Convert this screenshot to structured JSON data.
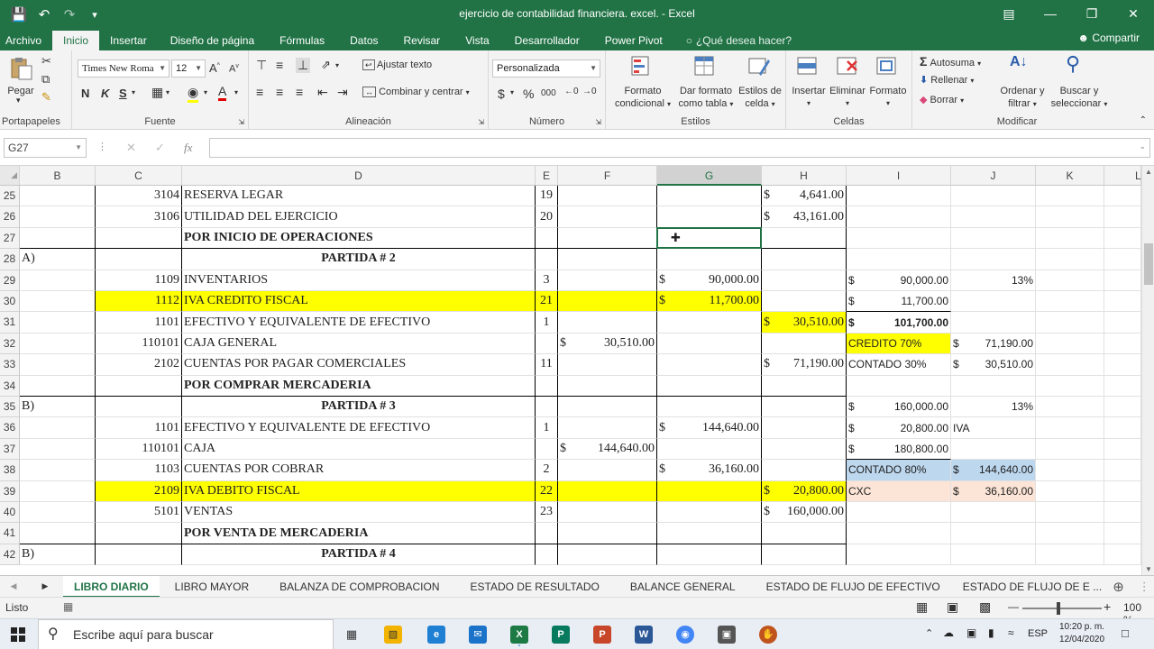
{
  "window": {
    "title": "ejercicio de contabilidad financiera. excel. - Excel",
    "qat": {
      "save": "save-icon",
      "undo": "undo-icon",
      "redo": "redo-icon",
      "customize": "customize-icon"
    }
  },
  "ribbon_tabs": [
    "Archivo",
    "Inicio",
    "Insertar",
    "Diseño de página",
    "Fórmulas",
    "Datos",
    "Revisar",
    "Vista",
    "Desarrollador",
    "Power Pivot"
  ],
  "tell_me": "¿Qué desea hacer?",
  "share": "Compartir",
  "ribbon": {
    "clipboard": {
      "paste": "Pegar",
      "label": "Portapapeles"
    },
    "font": {
      "name": "Times New Roma",
      "size": "12",
      "bold": "N",
      "italic": "K",
      "underline": "S",
      "label": "Fuente"
    },
    "alignment": {
      "wrap": "Ajustar texto",
      "merge": "Combinar y centrar",
      "label": "Alineación"
    },
    "number": {
      "format": "Personalizada",
      "currency": "$",
      "percent": "%",
      "thousands": "000",
      "label": "Número"
    },
    "styles": {
      "conditional": [
        "Formato",
        "condicional"
      ],
      "table": [
        "Dar formato",
        "como tabla"
      ],
      "cell_styles": [
        "Estilos de",
        "celda"
      ],
      "label": "Estilos"
    },
    "cells": {
      "insert": "Insertar",
      "delete": "Eliminar",
      "format": "Formato",
      "label": "Celdas"
    },
    "editing": {
      "autosum": "Autosuma",
      "fill": "Rellenar",
      "clear": "Borrar",
      "sort": [
        "Ordenar y",
        "filtrar"
      ],
      "find": [
        "Buscar y",
        "seleccionar"
      ],
      "label": "Modificar"
    }
  },
  "namebox": "G27",
  "columns": [
    "B",
    "C",
    "D",
    "E",
    "F",
    "G",
    "H",
    "I",
    "J",
    "K",
    "L"
  ],
  "rows": [
    {
      "n": "25",
      "B": "",
      "C": "3104",
      "D": "RESERVA LEGAR",
      "E": "19",
      "F": "",
      "G": "",
      "Hs": "$",
      "Hv": "4,641.00",
      "Is": "",
      "Iv": "",
      "J": "",
      "Js": ""
    },
    {
      "n": "26",
      "B": "",
      "C": "3106",
      "D": "UTILIDAD DEL EJERCICIO",
      "E": "20",
      "F": "",
      "G": "",
      "Hs": "$",
      "Hv": "43,161.00",
      "Is": "",
      "Iv": "",
      "J": "",
      "Js": ""
    },
    {
      "n": "27",
      "B": "",
      "C": "",
      "D": "POR INICIO DE OPERACIONES",
      "E": "",
      "F": "",
      "G": "",
      "Hs": "",
      "Hv": "",
      "Is": "",
      "Iv": "",
      "J": "",
      "Js": ""
    },
    {
      "n": "28",
      "B": "A)",
      "C": "",
      "D": "PARTIDA # 2",
      "E": "",
      "F": "",
      "G": "",
      "Hs": "",
      "Hv": "",
      "Is": "",
      "Iv": "",
      "J": "",
      "Js": ""
    },
    {
      "n": "29",
      "B": "",
      "C": "1109",
      "D": "INVENTARIOS",
      "E": "3",
      "F": "",
      "Gs": "$",
      "Gv": "90,000.00",
      "Hs": "",
      "Hv": "",
      "Is": "$",
      "Iv": "90,000.00",
      "J": "13%",
      "Js": ""
    },
    {
      "n": "30",
      "B": "",
      "C": "1112",
      "D": "IVA CREDITO FISCAL",
      "E": "21",
      "F": "",
      "Gs": "$",
      "Gv": "11,700.00",
      "Hs": "",
      "Hv": "",
      "Is": "$",
      "Iv": "11,700.00",
      "J": "",
      "Js": ""
    },
    {
      "n": "31",
      "B": "",
      "C": "1101",
      "D": "EFECTIVO Y EQUIVALENTE DE EFECTIVO",
      "E": "1",
      "F": "",
      "G": "",
      "Hs": "$",
      "Hv": "30,510.00",
      "Is": "$",
      "Iv": "101,700.00",
      "J": "",
      "Js": ""
    },
    {
      "n": "32",
      "B": "",
      "C": "110101",
      "D": "CAJA GENERAL",
      "E": "",
      "Fs": "$",
      "Fv": "30,510.00",
      "G": "",
      "Hs": "",
      "Hv": "",
      "Itext": "CREDITO   70%",
      "Js": "$",
      "Jv": "71,190.00"
    },
    {
      "n": "33",
      "B": "",
      "C": "2102",
      "D": "CUENTAS POR PAGAR COMERCIALES",
      "E": "11",
      "F": "",
      "G": "",
      "Hs": "$",
      "Hv": "71,190.00",
      "Itext": "CONTADO 30%",
      "Js": "$",
      "Jv": "30,510.00"
    },
    {
      "n": "34",
      "B": "",
      "C": "",
      "D": "POR COMPRAR MERCADERIA",
      "E": "",
      "F": "",
      "G": "",
      "Hs": "",
      "Hv": "",
      "Is": "",
      "Iv": "",
      "J": "",
      "Js": ""
    },
    {
      "n": "35",
      "B": "B)",
      "C": "",
      "D": "PARTIDA # 3",
      "E": "",
      "F": "",
      "G": "",
      "Hs": "",
      "Hv": "",
      "Is": "$",
      "Iv": "160,000.00",
      "J": "13%",
      "Js": ""
    },
    {
      "n": "36",
      "B": "",
      "C": "1101",
      "D": "EFECTIVO Y EQUIVALENTE DE EFECTIVO",
      "E": "1",
      "F": "",
      "Gs": "$",
      "Gv": "144,640.00",
      "Hs": "",
      "Hv": "",
      "Is": "$",
      "Iv": "20,800.00",
      "Jtext": "IVA"
    },
    {
      "n": "37",
      "B": "",
      "C": "110101",
      "D": "CAJA",
      "E": "",
      "Fs": "$",
      "Fv": "144,640.00",
      "G": "",
      "Hs": "",
      "Hv": "",
      "Is": "$",
      "Iv": "180,800.00",
      "J": "",
      "Js": ""
    },
    {
      "n": "38",
      "B": "",
      "C": "1103",
      "D": "CUENTAS POR COBRAR",
      "E": "2",
      "F": "",
      "Gs": "$",
      "Gv": "36,160.00",
      "Hs": "",
      "Hv": "",
      "Itext": "CONTADO 80%",
      "Js": "$",
      "Jv": "144,640.00"
    },
    {
      "n": "39",
      "B": "",
      "C": "2109",
      "D": "IVA DEBITO FISCAL",
      "E": "22",
      "F": "",
      "G": "",
      "Hs": "$",
      "Hv": "20,800.00",
      "Itext": "CXC",
      "Js": "$",
      "Jv": "36,160.00"
    },
    {
      "n": "40",
      "B": "",
      "C": "5101",
      "D": "VENTAS",
      "E": "23",
      "F": "",
      "G": "",
      "Hs": "$",
      "Hv": "160,000.00",
      "Is": "",
      "Iv": "",
      "J": "",
      "Js": ""
    },
    {
      "n": "41",
      "B": "",
      "C": "",
      "D": "POR VENTA DE MERCADERIA",
      "E": "",
      "F": "",
      "G": "",
      "Hs": "",
      "Hv": "",
      "Is": "",
      "Iv": "",
      "J": "",
      "Js": ""
    },
    {
      "n": "42",
      "B": "B)",
      "C": "",
      "D": "PARTIDA # 4",
      "E": "",
      "F": "",
      "G": "",
      "Hs": "",
      "Hv": "",
      "Is": "",
      "Iv": "",
      "J": "",
      "Js": ""
    }
  ],
  "sheet_tabs": [
    "LIBRO DIARIO",
    "LIBRO MAYOR",
    "BALANZA DE COMPROBACION",
    "ESTADO DE RESULTADO",
    "BALANCE GENERAL",
    "ESTADO DE FLUJO DE EFECTIVO",
    "ESTADO DE FLUJO DE E ..."
  ],
  "status": {
    "ready": "Listo",
    "zoom": "100 %"
  },
  "taskbar": {
    "search": "Escribe aquí para buscar",
    "lang": "ESP",
    "time": "10:20 p. m.",
    "date": "12/04/2020"
  },
  "colors": {
    "excel_green": "#217346",
    "highlight_yellow": "#ffff00",
    "blue_fill": "#bdd7ee",
    "pink_fill": "#fce4d6"
  }
}
